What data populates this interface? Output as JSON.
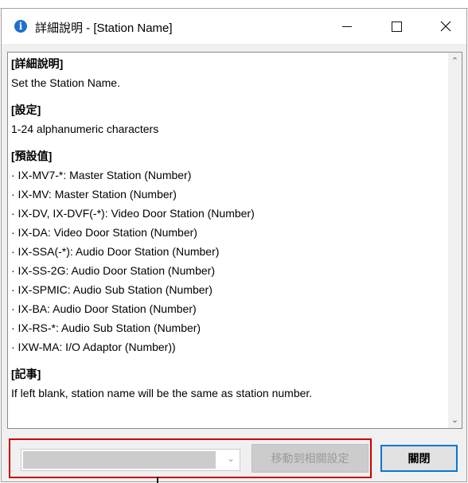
{
  "window": {
    "title": "詳細說明 - [Station Name]"
  },
  "content": {
    "sections": [
      {
        "heading": "[詳細說明]",
        "lines": [
          "Set the Station Name."
        ]
      },
      {
        "heading": "[設定]",
        "lines": [
          "1-24 alphanumeric characters"
        ]
      },
      {
        "heading": "[預設值]",
        "lines": [
          "· IX-MV7-*: Master Station (Number)",
          "· IX-MV: Master Station (Number)",
          "· IX-DV, IX-DVF(-*): Video Door Station (Number)",
          "· IX-DA: Video Door Station (Number)",
          "· IX-SSA(-*): Audio Door Station (Number)",
          "· IX-SS-2G: Audio Door Station (Number)",
          "· IX-SPMIC: Audio Sub Station (Number)",
          "· IX-BA: Audio Door Station (Number)",
          "· IX-RS-*: Audio Sub Station (Number)",
          "· IXW-MA: I/O Adaptor (Number))"
        ]
      },
      {
        "heading": "[記事]",
        "lines": [
          "If left blank, station name will be the same as station number."
        ]
      }
    ]
  },
  "footer": {
    "dropdown_value": "",
    "goto_button_label": "移動到相關設定",
    "close_button_label": "關閉"
  },
  "colors": {
    "highlight_border": "#cc0000",
    "default_button_border": "#0078d7",
    "app_icon": "#1f6fd1"
  },
  "icons": {
    "app": "info-icon",
    "minimize": "minimize-icon",
    "maximize": "maximize-icon",
    "close": "close-icon",
    "dropdown": "chevron-down-icon"
  }
}
